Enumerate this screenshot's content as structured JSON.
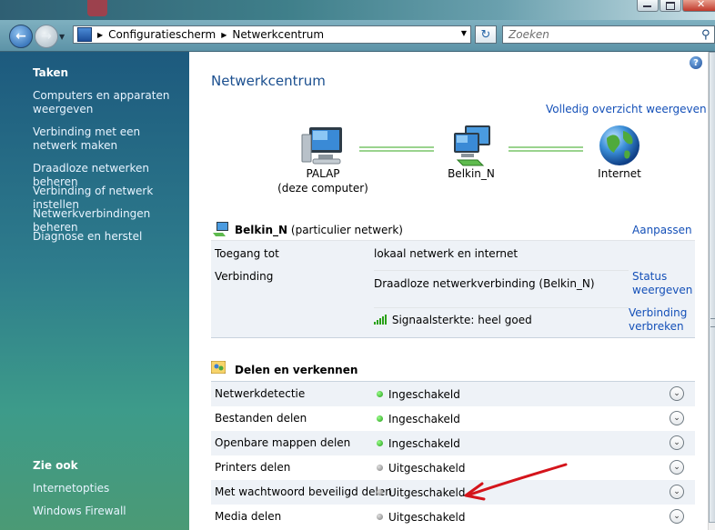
{
  "window": {
    "minimize_icon": "minimize-icon",
    "maximize_icon": "maximize-icon",
    "close_icon": "close-icon"
  },
  "address": {
    "root_icon": "network-control-panel-icon",
    "crumbs": [
      "Configuratiescherm",
      "Netwerkcentrum"
    ]
  },
  "search": {
    "placeholder": "Zoeken"
  },
  "sidebar": {
    "tasks_heading": "Taken",
    "tasks": [
      "Computers en apparaten weergeven",
      "Verbinding met een netwerk maken",
      "Draadloze netwerken beheren",
      "Verbinding of netwerk instellen",
      "Netwerkverbindingen beheren",
      "Diagnose en herstel"
    ],
    "see_also_heading": "Zie ook",
    "see_also": [
      "Internetopties",
      "Windows Firewall"
    ]
  },
  "main": {
    "title": "Netwerkcentrum",
    "full_map_link": "Volledig overzicht weergeven",
    "map": {
      "computer_name": "PALAP",
      "computer_sub": "(deze computer)",
      "network_name": "Belkin_N",
      "internet_label": "Internet"
    },
    "network": {
      "name": "Belkin_N",
      "type": "(particulier netwerk)",
      "customize": "Aanpassen",
      "access_label": "Toegang tot",
      "access_value": "lokaal netwerk en internet",
      "connection_label": "Verbinding",
      "connection_value": "Draadloze netwerkverbinding (Belkin_N)",
      "status_link_1": "Status",
      "status_link_2": "weergeven",
      "signal": "Signaalsterkte: heel goed",
      "disconnect_1": "Verbinding",
      "disconnect_2": "verbreken"
    },
    "sharing": {
      "heading": "Delen en verkennen",
      "rows": [
        {
          "label": "Netwerkdetectie",
          "value": "Ingeschakeld",
          "state": "on"
        },
        {
          "label": "Bestanden delen",
          "value": "Ingeschakeld",
          "state": "on"
        },
        {
          "label": "Openbare mappen delen",
          "value": "Ingeschakeld",
          "state": "on"
        },
        {
          "label": "Printers delen",
          "value": "Uitgeschakeld",
          "state": "off"
        },
        {
          "label": "Met wachtwoord beveiligd delen",
          "value": "Uitgeschakeld",
          "state": "off"
        },
        {
          "label": "Media delen",
          "value": "Uitgeschakeld",
          "state": "off"
        }
      ]
    }
  },
  "annotation": {
    "arrow_color": "#d4141b"
  }
}
